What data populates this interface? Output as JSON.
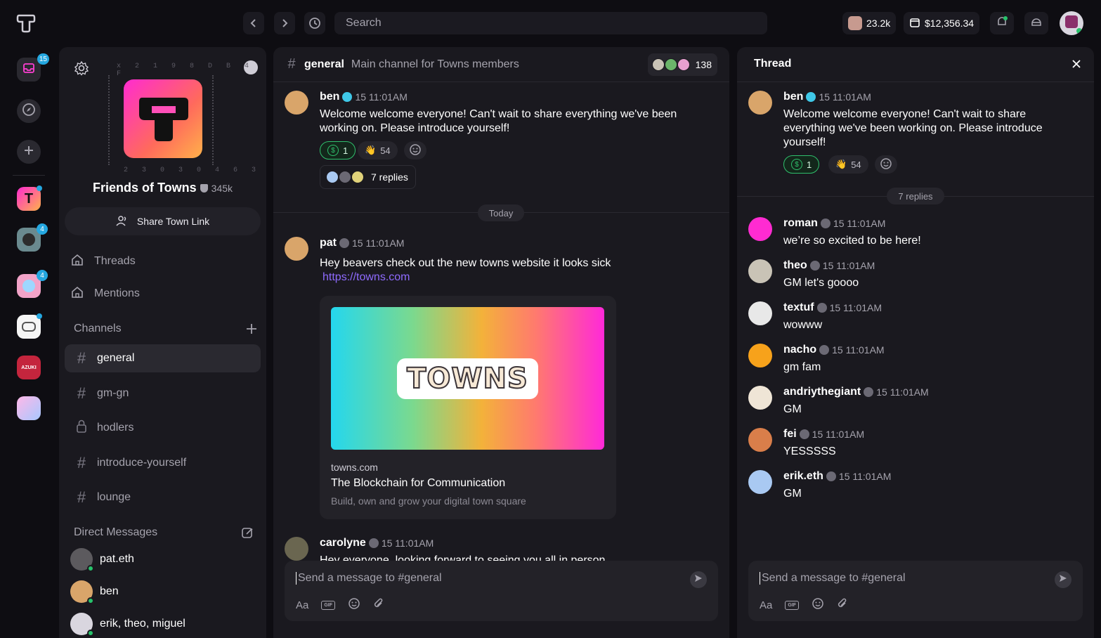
{
  "topbar": {
    "search_placeholder": "Search",
    "points": "23.2k",
    "balance": "$12,356.34"
  },
  "rail": {
    "inbox_badge": "15",
    "town_badges": [
      "4",
      "4"
    ],
    "azuki_label": "AZUKI"
  },
  "town": {
    "name": "Friends of Towns",
    "members": "345k",
    "ring_top": "x 2 1 9 8 D B 4 F",
    "ring_bottom": "2 3 0 3 0 4 6 3",
    "share_label": "Share Town Link"
  },
  "sidebar": {
    "threads_label": "Threads",
    "mentions_label": "Mentions",
    "channels_heading": "Channels",
    "channels": [
      {
        "name": "general",
        "icon": "hash"
      },
      {
        "name": "gm-gn",
        "icon": "hash"
      },
      {
        "name": "hodlers",
        "icon": "lock"
      },
      {
        "name": "introduce-yourself",
        "icon": "hash"
      },
      {
        "name": "lounge",
        "icon": "hash"
      }
    ],
    "dm_heading": "Direct Messages",
    "dms": [
      "pat.eth",
      "ben",
      "erik, theo, miguel"
    ]
  },
  "channel": {
    "name": "general",
    "description": "Main channel for Towns members",
    "member_count": "138",
    "day_divider": "Today",
    "composer_placeholder": "Send a message to #general",
    "font_tool": "Aa",
    "gif_tool": "GIF"
  },
  "messages": [
    {
      "user": "ben",
      "time": "15 11:01AM",
      "text": "Welcome welcome everyone! Can't wait to share everything we've been working on. Please introduce yourself!",
      "reactions": [
        {
          "emoji": "$",
          "count": "1"
        },
        {
          "emoji": "👋",
          "count": "54"
        }
      ],
      "replies": "7 replies"
    },
    {
      "user": "pat",
      "time": "15 11:01AM",
      "text": "Hey beavers check out the new towns website it looks sick",
      "link": "https://towns.com",
      "preview": {
        "logo_text": "TOWNS",
        "domain": "towns.com",
        "title": "The Blockchain for Communication",
        "description": "Build, own and grow your digital town square"
      }
    },
    {
      "user": "carolyne",
      "time": "15 11:01AM",
      "text": "Hey everyone, looking forward to seeing you all in person"
    }
  ],
  "thread": {
    "title": "Thread",
    "root": {
      "user": "ben",
      "time": "15 11:01AM",
      "text": "Welcome welcome everyone! Can't wait to share everything we've been working on. Please introduce yourself!",
      "reactions": [
        {
          "emoji": "$",
          "count": "1"
        },
        {
          "emoji": "👋",
          "count": "54"
        }
      ]
    },
    "replies_label": "7 replies",
    "replies": [
      {
        "user": "roman",
        "time": "15 11:01AM",
        "text": "we’re so excited to be here!",
        "color": "#ff2bd1"
      },
      {
        "user": "theo",
        "time": "15 11:01AM",
        "text": "GM let's goooo",
        "color": "#c9c3b6"
      },
      {
        "user": "textuf",
        "time": "15 11:01AM",
        "text": "wowww",
        "color": "#e8e8e8"
      },
      {
        "user": "nacho",
        "time": "15 11:01AM",
        "text": "gm fam",
        "color": "#f7a21b"
      },
      {
        "user": "andriythegiant",
        "time": "15 11:01AM",
        "text": "GM",
        "color": "#efe5d6"
      },
      {
        "user": "fei",
        "time": "15 11:01AM",
        "text": "YESSSSS",
        "color": "#d97e4a"
      },
      {
        "user": "erik.eth",
        "time": "15 11:01AM",
        "text": "GM",
        "color": "#a9c9f2"
      }
    ],
    "composer_placeholder": "Send a message to #general",
    "font_tool": "Aa",
    "gif_tool": "GIF"
  }
}
